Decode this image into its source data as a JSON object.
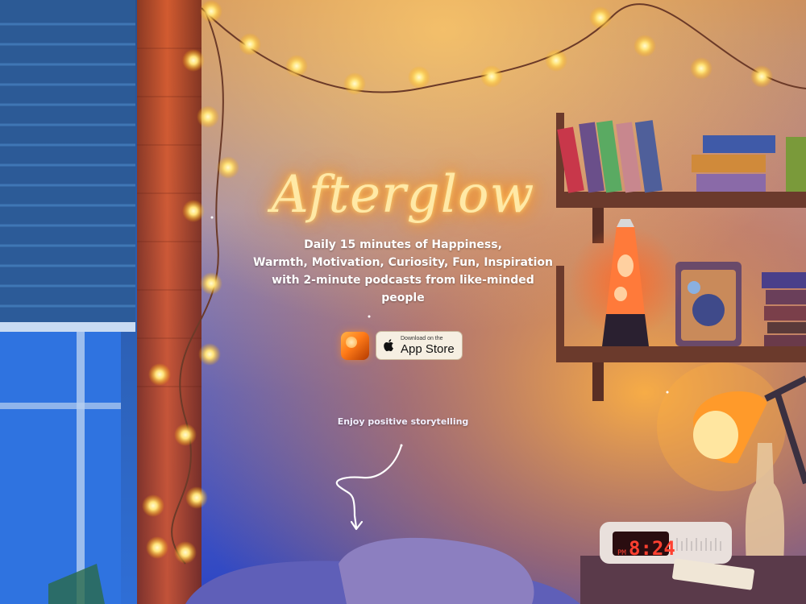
{
  "hero": {
    "title": "Afterglow",
    "tagline_lines": [
      "Daily 15 minutes of Happiness,",
      "Warmth, Motivation, Curiosity, Fun, Inspiration",
      "with 2-minute podcasts from like-minded",
      "people"
    ]
  },
  "store": {
    "app_icon": "afterglow-app-icon",
    "badge_small": "Download on the",
    "badge_big": "App Store",
    "badge_icon": "apple-icon"
  },
  "cta": {
    "enjoy": "Enjoy positive storytelling",
    "arrow_icon": "curly-arrow-down-icon"
  },
  "scene": {
    "clock_time": "8:24",
    "clock_label": "PM"
  },
  "colors": {
    "glow": "#ffd470",
    "wall_top": "#d5a06a",
    "wall_mid": "#9a86b9",
    "wall_bottom": "#344fcf",
    "lamp_orange": "#ff8a24"
  }
}
